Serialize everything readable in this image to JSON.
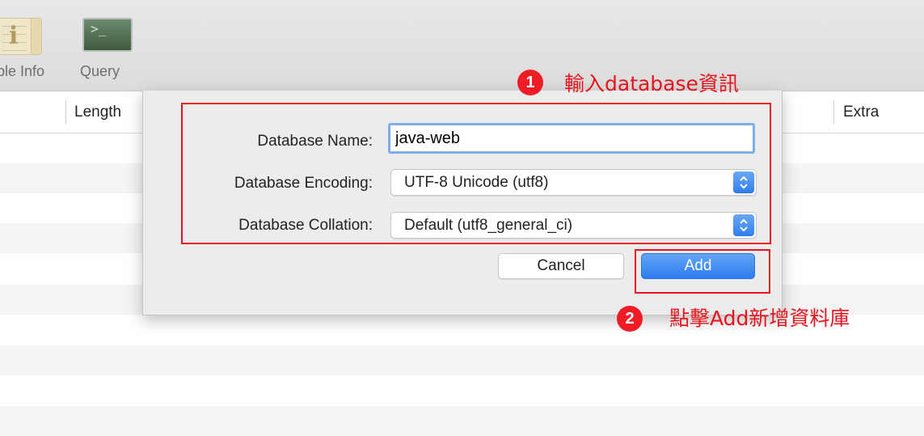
{
  "toolbar": {
    "items": [
      {
        "label": "ble Info",
        "icon": "table-info-icon"
      },
      {
        "label": "Query",
        "icon": "terminal-icon"
      }
    ]
  },
  "table": {
    "columns": [
      "Length",
      "Extra"
    ]
  },
  "dialog": {
    "name_label": "Database Name:",
    "name_value": "java-web",
    "encoding_label": "Database Encoding:",
    "encoding_value": "UTF-8 Unicode (utf8)",
    "collation_label": "Database Collation:",
    "collation_value": "Default (utf8_general_ci)",
    "cancel_label": "Cancel",
    "add_label": "Add"
  },
  "annotations": [
    {
      "number": "1",
      "text": "輸入database資訊"
    },
    {
      "number": "2",
      "text": "點擊Add新增資料庫"
    }
  ],
  "colors": {
    "annotation_red": "#e8131c",
    "accent_blue": "#2d7cf0",
    "focus_ring": "#7faee8"
  }
}
